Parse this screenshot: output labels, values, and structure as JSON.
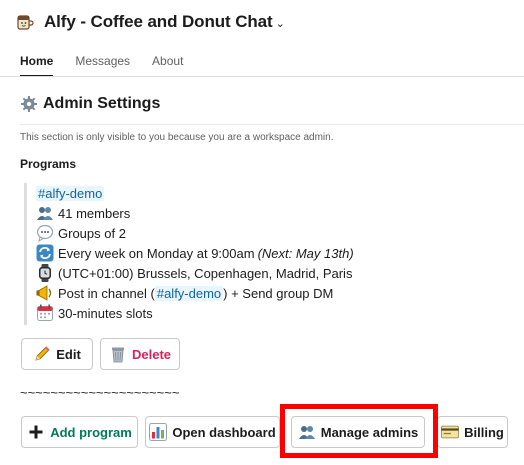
{
  "header": {
    "title": "Alfy - Coffee and Donut Chat",
    "chevron": "⌄",
    "icon": "coffee-cup-icon"
  },
  "tabs": [
    {
      "label": "Home",
      "active": true
    },
    {
      "label": "Messages",
      "active": false
    },
    {
      "label": "About",
      "active": false
    }
  ],
  "admin": {
    "title": "Admin Settings",
    "notice": "This section is only visible to you because you are a workspace admin.",
    "programs_label": "Programs"
  },
  "program": {
    "channel": "#alfy-demo",
    "members": "41 members",
    "groups": "Groups of 2",
    "schedule": "Every week on Monday at 9:00am",
    "schedule_next": "(Next: May 13th)",
    "timezone": "(UTC+01:00) Brussels, Copenhagen, Madrid, Paris",
    "post_prefix": "Post in channel (",
    "post_channel": "#alfy-demo",
    "post_suffix": ") + Send group DM",
    "slots": "30-minutes slots"
  },
  "actions": {
    "edit": "Edit",
    "delete": "Delete",
    "divider": "~~~~~~~~~~~~~~~~~~~~~",
    "add_program": "Add program",
    "open_dashboard": "Open dashboard",
    "manage_admins": "Manage admins",
    "billing": "Billing"
  },
  "colors": {
    "link": "#1264a3",
    "delete": "#e01e5a",
    "add": "#007a5a",
    "highlight": "#ff0000"
  }
}
